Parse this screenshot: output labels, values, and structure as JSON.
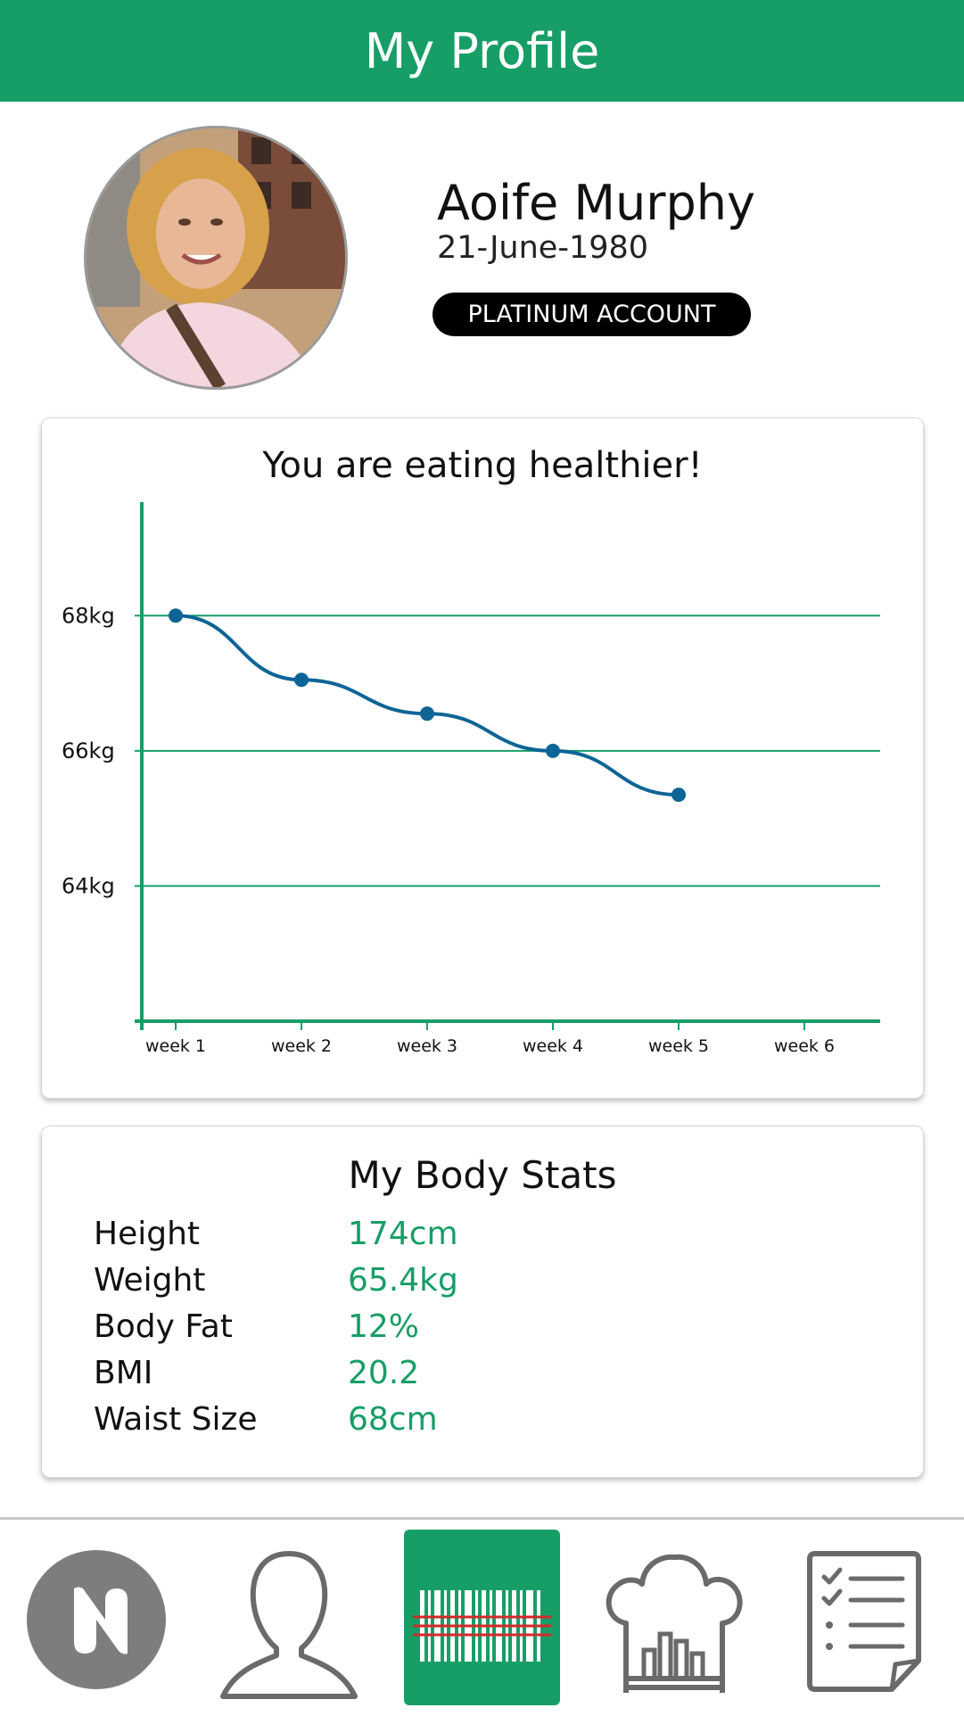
{
  "header": {
    "title": "My Profile",
    "color": "#179e66"
  },
  "profile": {
    "name": "Aoife Murphy",
    "dob": "21-June-1980",
    "account_badge": "PLATINUM ACCOUNT",
    "avatar_icon": "user-photo"
  },
  "chart_card": {
    "title": "You are eating healthier!"
  },
  "chart_data": {
    "type": "line",
    "title": "You are eating healthier!",
    "categories": [
      "week 1",
      "week 2",
      "week 3",
      "week 4",
      "week 5",
      "week 6"
    ],
    "y_tick_labels": [
      "68kg",
      "66kg",
      "64kg"
    ],
    "y_ticks": [
      68,
      66,
      64
    ],
    "series": [
      {
        "values": [
          68.0,
          67.05,
          66.55,
          66.0,
          65.35
        ],
        "color": "#0d6496"
      }
    ],
    "ylim": [
      62.0,
      69.6
    ],
    "grid": true,
    "axis_color": "#179e66"
  },
  "stats": {
    "title": "My Body Stats",
    "rows": [
      {
        "label": "Height",
        "value": "174cm"
      },
      {
        "label": "Weight",
        "value": "65.4kg"
      },
      {
        "label": "Body Fat",
        "value": "12%"
      },
      {
        "label": "BMI",
        "value": "20.2"
      },
      {
        "label": "Waist Size",
        "value": "68cm"
      }
    ]
  },
  "nav": {
    "items": [
      {
        "icon": "app-logo-icon"
      },
      {
        "icon": "profile-icon"
      },
      {
        "icon": "barcode-scanner-icon",
        "active": true
      },
      {
        "icon": "chef-hat-icon"
      },
      {
        "icon": "checklist-icon"
      }
    ],
    "active_color": "#179e66"
  }
}
